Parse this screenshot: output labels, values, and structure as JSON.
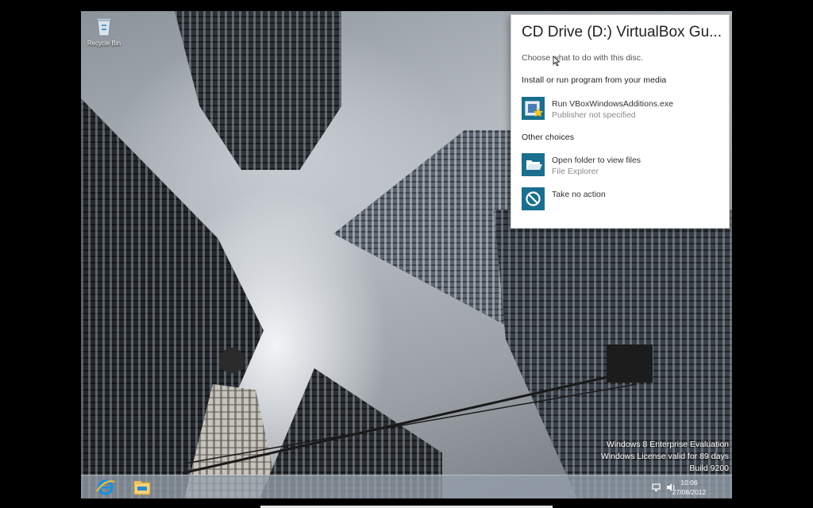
{
  "desktop": {
    "recycle_bin_label": "Recycle Bin"
  },
  "watermark": {
    "line1": "Windows 8 Enterprise Evaluation",
    "line2": "Windows License valid for 89 days",
    "line3": "Build 9200"
  },
  "taskbar": {
    "time": "10:06",
    "date": "27/08/2012",
    "pinned": [
      "internet-explorer-icon",
      "file-explorer-icon"
    ]
  },
  "autoplay": {
    "title": "CD Drive (D:) VirtualBox Gu...",
    "subtitle": "Choose what to do with this disc.",
    "section1": "Install or run program from your media",
    "option_run_name": "Run VBoxWindowsAdditions.exe",
    "option_run_desc": "Publisher not specified",
    "section2": "Other choices",
    "option_open_name": "Open folder to view files",
    "option_open_desc": "File Explorer",
    "option_none_name": "Take no action"
  },
  "colors": {
    "tile": "#1b6f8e",
    "taskbar": "#96a0ac"
  }
}
